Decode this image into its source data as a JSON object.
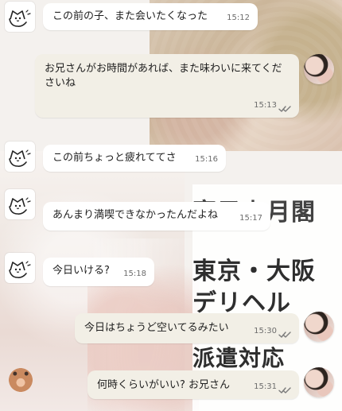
{
  "promo": {
    "line1": "寝子上月閣",
    "line2": "東京・大阪",
    "line3": "デリヘル",
    "line4": "派遣対応"
  },
  "messages": [
    {
      "side": "left",
      "text": "この前の子、また会いたくなった",
      "time": "15:12",
      "read": false
    },
    {
      "side": "right",
      "text": "お兄さんがお時間があれば、また味わいに来てくださいね",
      "time": "15:13",
      "read": true
    },
    {
      "side": "left",
      "text": "この前ちょっと疲れててさ",
      "time": "15:16",
      "read": false
    },
    {
      "side": "left",
      "text": "あんまり満喫できなかったんだよね",
      "time": "15:17",
      "read": false
    },
    {
      "side": "left",
      "text": "今日いける?",
      "time": "15:18",
      "read": false
    },
    {
      "side": "right",
      "text": "今日はちょうど空いてるみたい",
      "time": "15:30",
      "read": true
    },
    {
      "side": "right",
      "text": "何時くらいがいい? お兄さん",
      "time": "15:31",
      "read": true
    }
  ],
  "colors": {
    "bubble_white": "#ffffff",
    "bubble_cream": "#f2efe6",
    "promo_text": "#2e2e2e",
    "time_text": "#6c6c6c"
  },
  "icons": {
    "cat_avatar": "cat-avatar-icon",
    "double_check": "double-check-icon",
    "person_avatar": "person-avatar-icon"
  }
}
